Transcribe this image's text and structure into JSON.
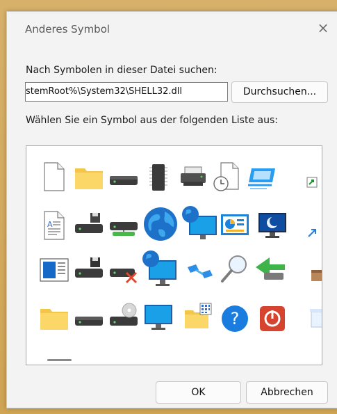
{
  "dialog": {
    "title": "Anderes Symbol",
    "close_glyph": "×",
    "search_label": "Nach Symbolen in dieser Datei suchen:",
    "path_value": "stemRoot%\\System32\\SHELL32.dll",
    "browse_label": "Durchsuchen...",
    "list_label": "Wählen Sie ein Symbol aus der folgenden Liste aus:",
    "ok_label": "OK",
    "cancel_label": "Abbrechen"
  },
  "icons": {
    "row1": [
      "document-icon",
      "folder-icon",
      "drive-icon",
      "memory-chip-icon",
      "printer-icon",
      "document-clock-icon",
      "network-window-icon",
      "shortcut-arrow-icon"
    ],
    "row2": [
      "text-document-icon",
      "floppy-drive-icon",
      "network-drive-icon",
      "globe-icon",
      "globe-monitor-icon",
      "control-panel-icon",
      "display-moon-icon",
      "shortcut-arrow-small-icon"
    ],
    "row3": [
      "window-list-icon",
      "floppy-drive-dark-icon",
      "drive-error-icon",
      "globe-monitor-network-icon",
      "network-connection-icon",
      "magnifier-icon",
      "recycle-arrow-icon",
      "box-icon"
    ],
    "row4": [
      "folder-icon",
      "drive-icon",
      "cd-drive-icon",
      "monitor-icon",
      "folder-grid-icon",
      "help-icon",
      "shutdown-icon",
      "trash-icon"
    ]
  }
}
